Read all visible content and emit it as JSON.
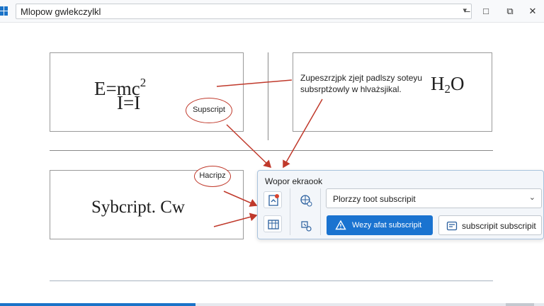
{
  "window": {
    "title": "Mlopow gwlekczylkl",
    "controls": {
      "minimize": "–",
      "maximize": "□",
      "restore": "⧉",
      "close": "✕"
    }
  },
  "document": {
    "top_left_box": {
      "line1_base": "E=mc",
      "line1_sup": "2",
      "line2": "I=I"
    },
    "top_right_box": {
      "note_line1": "Zupeszrzjpk zjejt padlszy soteyu",
      "note_line2": "subsrptżowly w hlvażsjikal.",
      "formula_h": "H",
      "formula_sub": "2",
      "formula_o": "O"
    },
    "bottom_left_box": {
      "text": "Sybcript. Cw"
    }
  },
  "callouts": {
    "subscript": "Supscript",
    "hacripz": "Hacripz"
  },
  "popup": {
    "title": "Wopor ekraook",
    "combo_value": "Plorzzy toot subscripit",
    "primary_button": "Wezy afat subscripit",
    "secondary_button": "subscripit subscripit"
  },
  "colors": {
    "accent": "#1a73d0",
    "annotation": "#c0392b",
    "popup_border": "#a9c3dd"
  }
}
